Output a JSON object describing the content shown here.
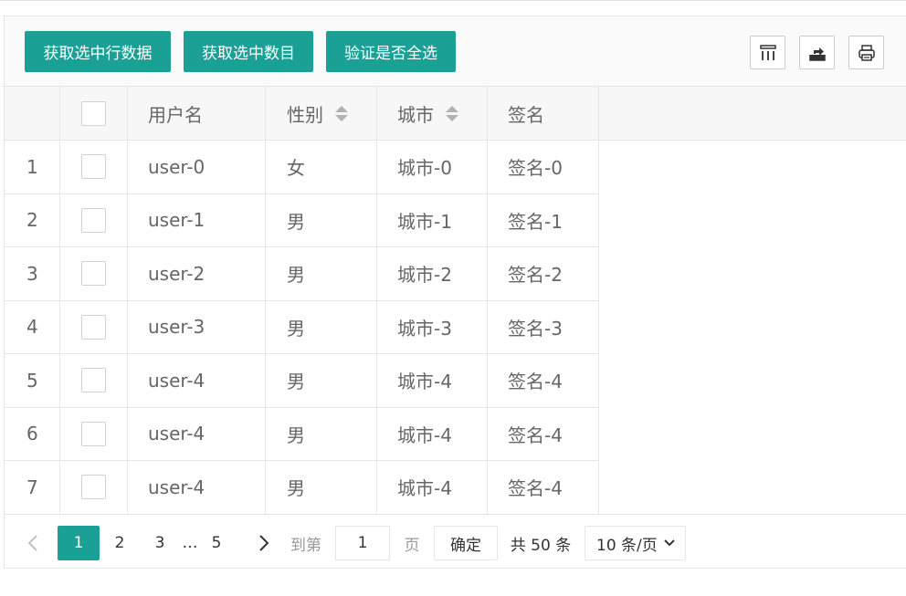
{
  "toolbar": {
    "buttons": [
      "获取选中行数据",
      "获取选中数目",
      "验证是否全选"
    ],
    "tool_icons": [
      "columns-icon",
      "export-icon",
      "print-icon"
    ]
  },
  "table": {
    "headers": {
      "username": "用户名",
      "sex": "性别",
      "city": "城市",
      "sign": "签名"
    },
    "rows": [
      {
        "index": "1",
        "username": "user-0",
        "sex": "女",
        "city": "城市-0",
        "sign": "签名-0"
      },
      {
        "index": "2",
        "username": "user-1",
        "sex": "男",
        "city": "城市-1",
        "sign": "签名-1"
      },
      {
        "index": "3",
        "username": "user-2",
        "sex": "男",
        "city": "城市-2",
        "sign": "签名-2"
      },
      {
        "index": "4",
        "username": "user-3",
        "sex": "男",
        "city": "城市-3",
        "sign": "签名-3"
      },
      {
        "index": "5",
        "username": "user-4",
        "sex": "男",
        "city": "城市-4",
        "sign": "签名-4"
      },
      {
        "index": "6",
        "username": "user-4",
        "sex": "男",
        "city": "城市-4",
        "sign": "签名-4"
      },
      {
        "index": "7",
        "username": "user-4",
        "sex": "男",
        "city": "城市-4",
        "sign": "签名-4"
      }
    ]
  },
  "pager": {
    "prev": "‹",
    "current": "1",
    "page2": "2",
    "page3": "3",
    "ellipsis": "…",
    "last": "5",
    "next": "›",
    "goto_label": "到第",
    "jump_value": "1",
    "page_unit": "页",
    "confirm": "确定",
    "total": "共 50 条",
    "limit": "10 条/页"
  },
  "colors": {
    "accent": "#1aa094",
    "border": "#e6e6e6"
  }
}
